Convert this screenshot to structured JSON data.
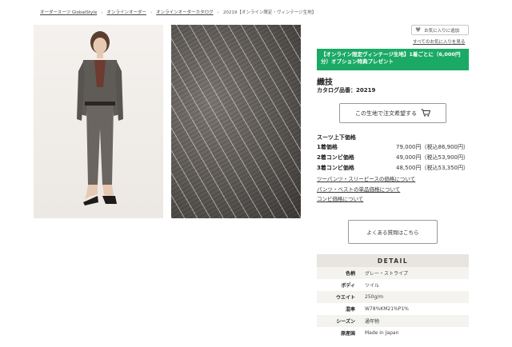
{
  "breadcrumb": [
    "オーダースーツ GlobalStyle",
    "オンラインオーダー",
    "オンラインオーダーカタログ",
    "20219【オンライン限定・ヴィンテージ生地】"
  ],
  "favorite": {
    "add_label": "お気に入りに追加",
    "list_link": "すべてのお気に入りを見る",
    "icon": "heart-icon"
  },
  "promo": {
    "line1": "【オンライン限定ヴィンテージ生地】1着ごとに（6,000円",
    "line2": "分）オプション特典プレゼント",
    "color": "#1aaa65"
  },
  "fabric_name": "織技",
  "catalog_number": "カタログ品番：20219",
  "order_button": {
    "label": "この生地で注文希望する",
    "icon": "cart-icon"
  },
  "prices": {
    "title": "スーツ上下価格",
    "rows": [
      {
        "label": "1着価格",
        "value": "79,000円（税込86,900円）"
      },
      {
        "label": "2着コンビ価格",
        "value": "49,000円（税込53,900円）"
      },
      {
        "label": "3着コンビ価格",
        "value": "48,500円（税込53,350円）"
      }
    ]
  },
  "links": [
    "ツーパンツ・スリーピースの価格について",
    "パンツ・ベストの単品価格について",
    "コンビ価格について"
  ],
  "faq_button": {
    "label": "よくある質問はこちら"
  },
  "detail": {
    "heading": "DETAIL",
    "rows": [
      {
        "key": "色柄",
        "value": "グレー・ストライプ"
      },
      {
        "key": "ボディ",
        "value": "ツイル"
      },
      {
        "key": "ウエイト",
        "value": "250g/m"
      },
      {
        "key": "混率",
        "value": "W78%KM21%P1%"
      },
      {
        "key": "シーズン",
        "value": "通年物"
      },
      {
        "key": "原産国",
        "value": "Made in Japan"
      }
    ]
  }
}
